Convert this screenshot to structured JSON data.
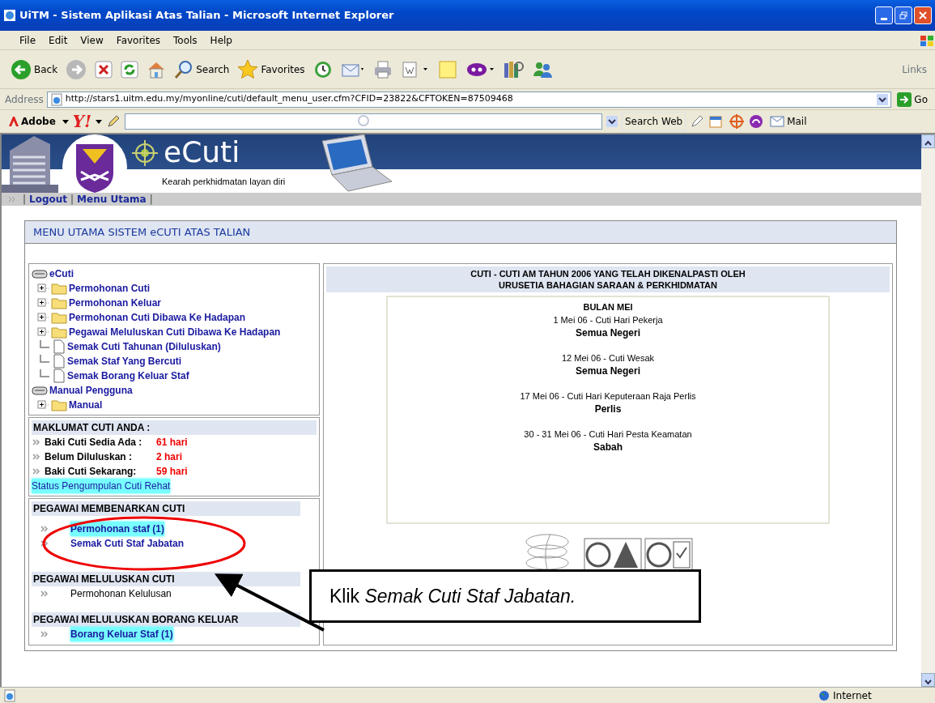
{
  "window": {
    "title": "UiTM - Sistem Aplikasi Atas Talian - Microsoft Internet Explorer"
  },
  "menu_bar": [
    "File",
    "Edit",
    "View",
    "Favorites",
    "Tools",
    "Help"
  ],
  "toolbar": {
    "back": "Back",
    "search": "Search",
    "favorites": "Favorites",
    "links": "Links"
  },
  "address_bar": {
    "label": "Address",
    "url": "http://stars1.uitm.edu.my/myonline/cuti/default_menu_user.cfm?CFID=23822&CFTOKEN=87509468",
    "go": "Go"
  },
  "search_toolbar": {
    "adobe": "Adobe",
    "yahoo_logo": "Y!",
    "search_web": "Search Web",
    "mail": "Mail"
  },
  "banner": {
    "title": "eCuti",
    "tagline": "Kearah perkhidmatan layan diri"
  },
  "nav_links": [
    {
      "kind": "separator",
      "text": "|"
    },
    {
      "kind": "link",
      "text": "Logout"
    },
    {
      "kind": "separator",
      "text": "|"
    },
    {
      "kind": "link",
      "text": "Menu Utama"
    },
    {
      "kind": "separator",
      "text": "|"
    }
  ],
  "panel_title": "MENU UTAMA SISTEM eCUTI ATAS TALIAN",
  "tree": [
    {
      "kind": "root",
      "label": "eCuti",
      "children": [
        {
          "kind": "folder",
          "label": "Permohonan Cuti",
          "expanded": false
        },
        {
          "kind": "folder",
          "label": "Permohonan Keluar",
          "expanded": false
        },
        {
          "kind": "folder",
          "label": "Permohonan Cuti Dibawa Ke Hadapan",
          "expanded": false
        },
        {
          "kind": "folder",
          "label": "Pegawai Meluluskan Cuti Dibawa Ke Hadapan",
          "expanded": false
        },
        {
          "kind": "page",
          "label": "Semak Cuti Tahunan (Diluluskan)"
        },
        {
          "kind": "page",
          "label": "Semak Staf Yang Bercuti"
        },
        {
          "kind": "page",
          "label": "Semak Borang Keluar Staf"
        }
      ]
    },
    {
      "kind": "root",
      "label": "Manual Pengguna",
      "children": [
        {
          "kind": "folder",
          "label": "Manual",
          "expanded": false
        }
      ]
    }
  ],
  "leave_info": {
    "heading": "MAKLUMAT CUTI ANDA :",
    "rows": [
      {
        "label": "Baki Cuti Sedia Ada :",
        "value": "61 hari"
      },
      {
        "label": "Belum Diluluskan :",
        "value": "2 hari"
      },
      {
        "label": "Baki Cuti Sekarang:",
        "value": "59 hari"
      }
    ],
    "link": {
      "text": "Status Pengumpulan Cuti Rehat",
      "highlighted": true
    }
  },
  "sections": [
    {
      "heading": "PEGAWAI MEMBENARKAN CUTI",
      "items": [
        {
          "kind": "link",
          "text": "Permohonan staf (1)",
          "highlighted": true
        },
        {
          "kind": "link",
          "text": "Semak Cuti Staf Jabatan",
          "highlighted": false
        }
      ]
    },
    {
      "heading": "PEGAWAI MELULUSKAN CUTI",
      "items": [
        {
          "kind": "plain",
          "text": "Permohonan Kelulusan",
          "highlighted": false
        }
      ]
    },
    {
      "heading": "PEGAWAI MELULUSKAN BORANG KELUAR",
      "items": [
        {
          "kind": "link",
          "text": "Borang Keluar Staf  (1)",
          "highlighted": true
        }
      ]
    }
  ],
  "holidays": {
    "title_lines": [
      "CUTI - CUTI AM TAHUN 2006 YANG TELAH DIKENALPASTI OLEH",
      "URUSETIA BAHAGIAN SARAAN & PERKHIDMATAN"
    ],
    "month": "BULAN MEI",
    "entries": [
      {
        "event": "1 Mei 06 - Cuti Hari Pekerja",
        "region": "Semua Negeri"
      },
      {
        "event": "12 Mei 06 - Cuti Wesak",
        "region": "Semua Negeri"
      },
      {
        "event": "17 Mei 06 - Cuti Hari Keputeraan Raja Perlis",
        "region": "Perlis"
      },
      {
        "event": "30 - 31 Mei 06 - Cuti Hari Pesta Keamatan",
        "region": "Sabah"
      }
    ]
  },
  "annotation": {
    "callout": "Klik *Semak Cuti Staf Jabatan.*"
  },
  "status_bar": {
    "zone": "Internet"
  }
}
